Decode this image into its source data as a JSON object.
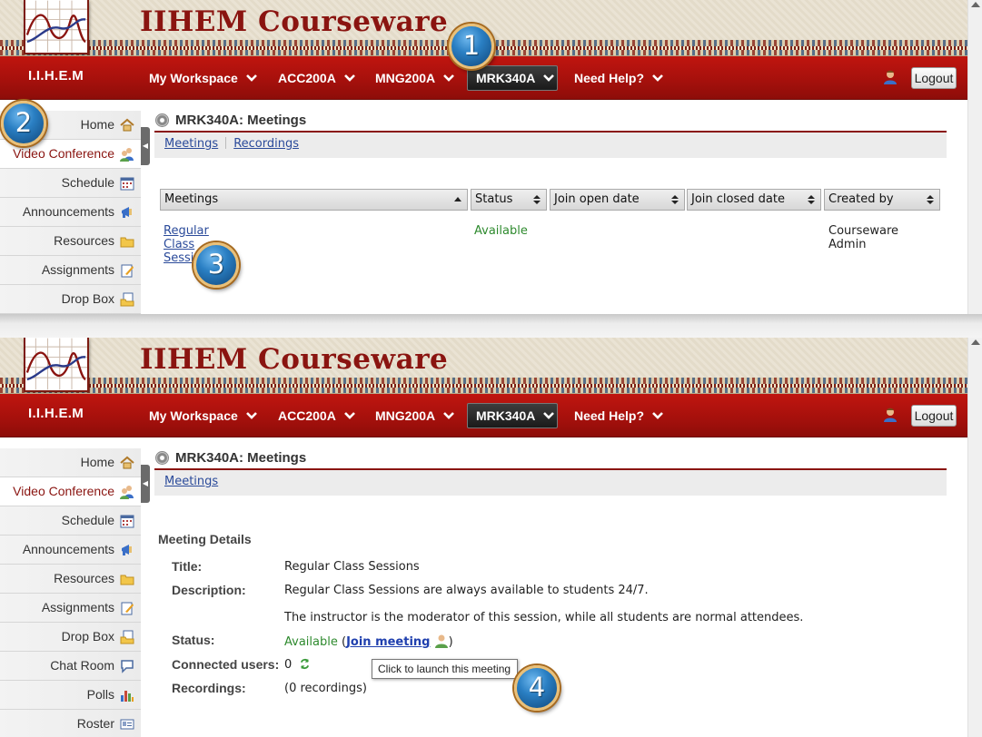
{
  "site": {
    "brand": "IIHEM Courseware",
    "site_name": "I.I.H.E.M"
  },
  "nav": {
    "items": [
      {
        "label": "My Workspace"
      },
      {
        "label": "ACC200A"
      },
      {
        "label": "MNG200A"
      },
      {
        "label": "MRK340A",
        "current": true
      },
      {
        "label": "Need Help?"
      }
    ],
    "logout_label": "Logout"
  },
  "panel1": {
    "sidebar": [
      "Home",
      "Video Conference",
      "Schedule",
      "Announcements",
      "Resources",
      "Assignments",
      "Drop Box"
    ],
    "active_sidebar": "Video Conference",
    "page_title": "MRK340A: Meetings",
    "subnav": [
      "Meetings",
      "Recordings"
    ],
    "table": {
      "headers": [
        "Meetings",
        "Status",
        "Join open date",
        "Join closed date",
        "Created by"
      ],
      "rows": [
        {
          "meeting": "Regular Class Sessions",
          "status": "Available",
          "join_open": "",
          "join_closed": "",
          "created_by": "Courseware Admin"
        }
      ]
    }
  },
  "panel2": {
    "sidebar": [
      "Home",
      "Video Conference",
      "Schedule",
      "Announcements",
      "Resources",
      "Assignments",
      "Drop Box",
      "Chat Room",
      "Polls",
      "Roster"
    ],
    "active_sidebar": "Video Conference",
    "page_title": "MRK340A: Meetings",
    "subnav": [
      "Meetings"
    ],
    "details": {
      "heading": "Meeting Details",
      "title_label": "Title:",
      "title_value": "Regular Class Sessions",
      "description_label": "Description:",
      "description_line1": "Regular Class Sessions are always available to students 24/7.",
      "description_line2": "The instructor is the moderator of this session, while all students are normal attendees.",
      "status_label": "Status:",
      "status_value": "Available",
      "join_link": "Join meeting",
      "connected_label": "Connected users:",
      "connected_value": "0",
      "recordings_label": "Recordings:",
      "recordings_value": "(0 recordings)"
    },
    "tooltip": "Click to launch this meeting"
  },
  "callouts": [
    "1",
    "2",
    "3",
    "4"
  ],
  "colors": {
    "brand_red": "#8a1410",
    "nav_red": "#b0120d",
    "link_blue": "#2a4a9a",
    "available_green": "#2e8a2e"
  }
}
